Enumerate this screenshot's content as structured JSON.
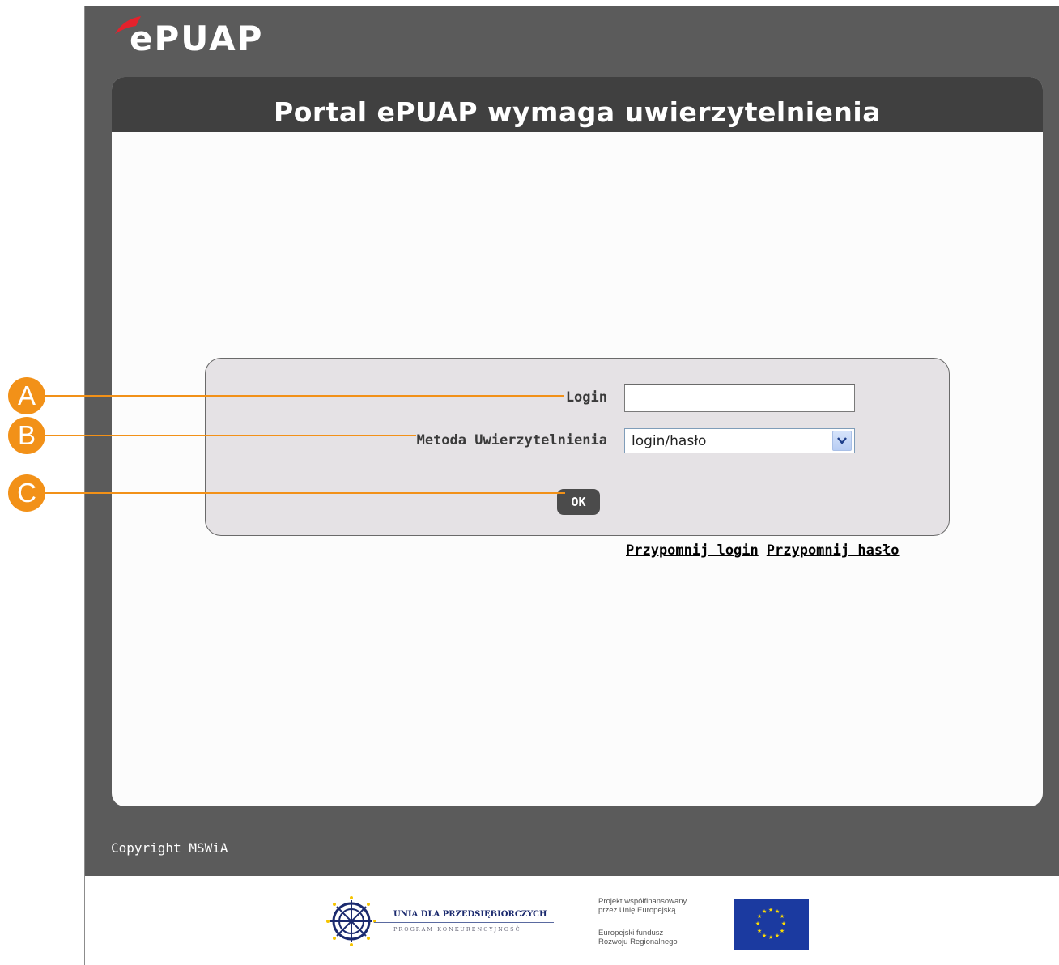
{
  "logo": {
    "text": "ePUAP",
    "accent_color": "#e4222c"
  },
  "panel": {
    "title": "Portal ePUAP wymaga uwierzytelnienia"
  },
  "form": {
    "login_label": "Login",
    "login_value": "",
    "method_label": "Metoda Uwierzytelnienia",
    "method_value": "login/hasło",
    "ok_label": "OK"
  },
  "links": {
    "remind_login": "Przypomnij login",
    "remind_password": "Przypomnij hasło"
  },
  "footer": {
    "copyright": "Copyright MSWiA",
    "unia_title": "UNIA DLA PRZEDSIĘBIORCZYCH",
    "unia_subtitle": "PROGRAM KONKURENCYJNOŚĆ",
    "project_line1": "Projekt współfinansowany",
    "project_line2": "przez Unię Europejską",
    "fund_line1": "Europejski fundusz",
    "fund_line2": "Rozwoju Regionalnego",
    "eu_flag_icon": "eu-flag-icon"
  },
  "callouts": {
    "a": "A",
    "b": "B",
    "c": "C",
    "color": "#f29118"
  },
  "colors": {
    "frame": "#5b5b5b",
    "header": "#404040",
    "login_box": "#e5e2e5",
    "button": "#4b4b4b"
  }
}
